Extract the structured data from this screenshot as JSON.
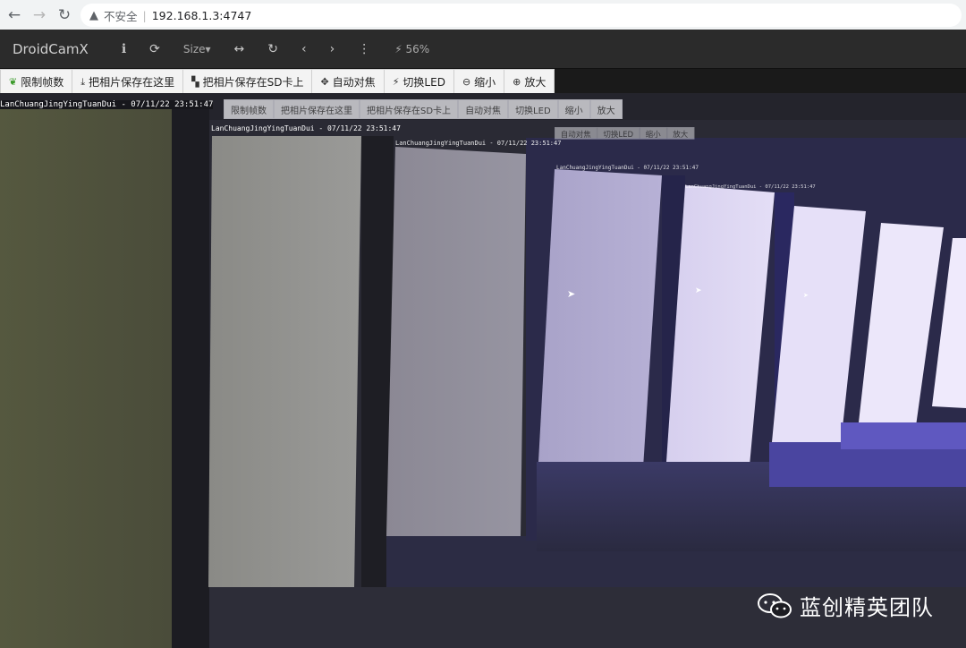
{
  "browser": {
    "warning_text": "不安全",
    "url": "192.168.1.3:4747"
  },
  "navbar": {
    "brand": "DroidCamX",
    "size_label": "Size",
    "battery": "56%"
  },
  "toolbar": {
    "buttons": [
      {
        "label": "限制帧数",
        "icon": "leaf-icon"
      },
      {
        "label": "把相片保存在这里",
        "icon": "download-icon"
      },
      {
        "label": "把相片保存在SD卡上",
        "icon": "sd-card-icon"
      },
      {
        "label": "自动对焦",
        "icon": "crosshair-icon"
      },
      {
        "label": "切换LED",
        "icon": "bolt-icon"
      },
      {
        "label": "缩小",
        "icon": "zoom-out-icon"
      },
      {
        "label": "放大",
        "icon": "zoom-in-icon"
      }
    ]
  },
  "feed": {
    "timestamp": "LanChuangJingYingTuanDui - 07/11/22 23:51:47",
    "watermark": "蓝创精英团队"
  },
  "colors": {
    "navbar_bg": "#2b2b2b",
    "toolbar_bg": "#f3f3f3",
    "leaf_green": "#3a9a2a"
  }
}
